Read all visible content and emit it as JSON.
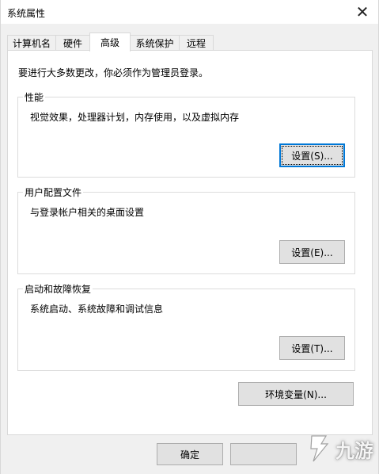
{
  "window": {
    "title": "系统属性",
    "close_glyph": "✕"
  },
  "tabs": [
    {
      "label": "计算机名"
    },
    {
      "label": "硬件"
    },
    {
      "label": "高级",
      "active": true
    },
    {
      "label": "系统保护"
    },
    {
      "label": "远程"
    }
  ],
  "advanced": {
    "intro": "要进行大多数更改，你必须作为管理员登录。",
    "performance": {
      "label": "性能",
      "description": "视觉效果，处理器计划，内存使用，以及虚拟内存",
      "button": "设置(S)..."
    },
    "user_profiles": {
      "label": "用户配置文件",
      "description": "与登录帐户相关的桌面设置",
      "button": "设置(E)..."
    },
    "startup_recovery": {
      "label": "启动和故障恢复",
      "description": "系统启动、系统故障和调试信息",
      "button": "设置(T)..."
    },
    "env_button": "环境变量(N)..."
  },
  "footer": {
    "ok": "确定"
  },
  "watermark": {
    "text": "九游",
    "icon": "jiuyou-logo-icon"
  }
}
